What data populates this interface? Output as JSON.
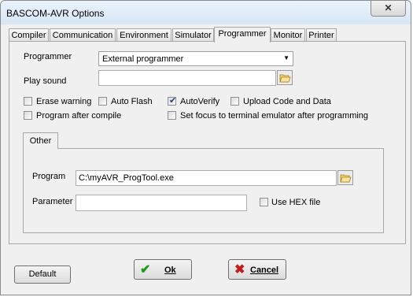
{
  "window": {
    "title": "BASCOM-AVR Options",
    "close_label": "✕"
  },
  "tabs": [
    {
      "label": "Compiler"
    },
    {
      "label": "Communication"
    },
    {
      "label": "Environment"
    },
    {
      "label": "Simulator"
    },
    {
      "label": "Programmer"
    },
    {
      "label": "Monitor"
    },
    {
      "label": "Printer"
    }
  ],
  "programmer": {
    "programmer_label": "Programmer",
    "programmer_value": "External programmer",
    "play_sound_label": "Play sound",
    "play_sound_value": ""
  },
  "checkboxes": {
    "erase_warning": {
      "label": "Erase warning",
      "checked": false
    },
    "auto_flash": {
      "label": "Auto Flash",
      "checked": false
    },
    "autoverify": {
      "label": "AutoVerify",
      "checked": true
    },
    "upload_code": {
      "label": "Upload Code and Data",
      "checked": false
    },
    "program_after_compile": {
      "label": "Program after compile",
      "checked": false
    },
    "set_focus": {
      "label": "Set focus to terminal emulator after programming",
      "checked": false
    },
    "use_hex": {
      "label": "Use HEX file",
      "checked": false
    }
  },
  "other": {
    "tab_label": "Other",
    "program_label": "Program",
    "program_value": "C:\\myAVR_ProgTool.exe",
    "parameter_label": "Parameter",
    "parameter_value": ""
  },
  "buttons": {
    "default": "Default",
    "ok": "Ok",
    "cancel": "Cancel"
  },
  "colors": {
    "ok_icon": "#1a9a1a",
    "cancel_icon": "#c0201a",
    "check": "#1f3c8a"
  }
}
